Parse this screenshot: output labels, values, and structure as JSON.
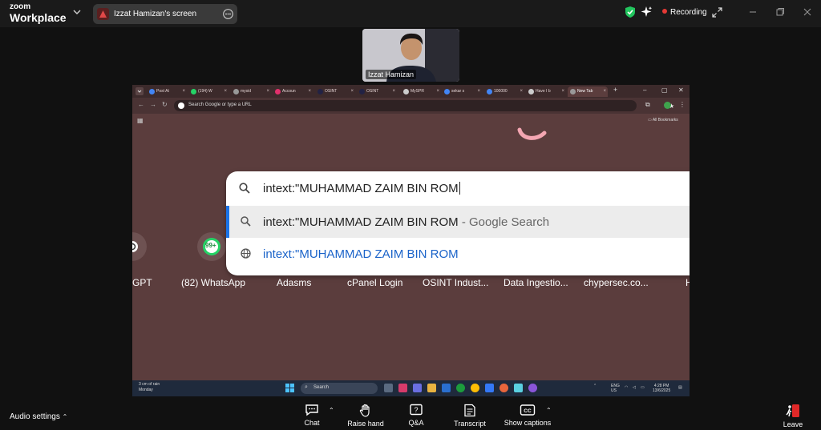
{
  "zoom": {
    "brand_line1": "zoom",
    "brand_line2": "Workplace",
    "screen_share_label": "Izzat Hamizan's screen",
    "recording_label": "Recording",
    "participant_name": "Izzat Hamizan",
    "audio_settings": "Audio settings",
    "controls": [
      {
        "label": "Chat",
        "icon": "chat-icon"
      },
      {
        "label": "Raise hand",
        "icon": "hand-icon"
      },
      {
        "label": "Q&A",
        "icon": "qa-icon"
      },
      {
        "label": "Transcript",
        "icon": "transcript-icon"
      },
      {
        "label": "Show captions",
        "icon": "captions-icon"
      }
    ],
    "leave_label": "Leave"
  },
  "browser": {
    "tabs": [
      {
        "label": "Post At",
        "color": "#4285f4"
      },
      {
        "label": "(194) W",
        "color": "#25d366"
      },
      {
        "label": "mysid",
        "color": "#999999"
      },
      {
        "label": "Accoun",
        "color": "#e1306c"
      },
      {
        "label": "OSINT",
        "color": "#222244"
      },
      {
        "label": "OSINT",
        "color": "#222244"
      },
      {
        "label": "MySPR",
        "color": "#cccccc"
      },
      {
        "label": "sekar s",
        "color": "#4285f4"
      },
      {
        "label": "100000",
        "color": "#4285f4"
      },
      {
        "label": "Have I b",
        "color": "#cccccc"
      },
      {
        "label": "New Tab",
        "color": "#999999"
      }
    ],
    "omnibox_placeholder": "Search Google or type a URL",
    "all_bookmarks": "All Bookmarks",
    "shortcuts": [
      {
        "label": "GPT"
      },
      {
        "label": "(82) WhatsApp",
        "badge": "99+"
      },
      {
        "label": "Adasms"
      },
      {
        "label": "cPanel Login"
      },
      {
        "label": "OSINT Indust..."
      },
      {
        "label": "Data Ingestio..."
      },
      {
        "label": "chypersec.co..."
      },
      {
        "label": "H"
      }
    ],
    "dropdown": {
      "query": "intext:\"MUHAMMAD ZAIM BIN ROM",
      "suggestion_text": "intext:\"MUHAMMAD ZAIM BIN ROM",
      "suggestion_suffix": " - Google Search",
      "url_suggestion": "intext:\"MUHAMMAD ZAIM BIN ROM"
    }
  },
  "taskbar": {
    "weather_line1": "3 cm of rain",
    "weather_line2": "Monday",
    "search_label": "Search",
    "lang_line1": "ENG",
    "lang_line2": "US",
    "time": "4:28 PM",
    "date": "13/6/2025"
  },
  "colors": {
    "share_bg": "#5b3d3d",
    "accent_blue": "#1a73e8",
    "recording_red": "#e53935",
    "shield_green": "#22c55e",
    "leave_red": "#e02828"
  }
}
